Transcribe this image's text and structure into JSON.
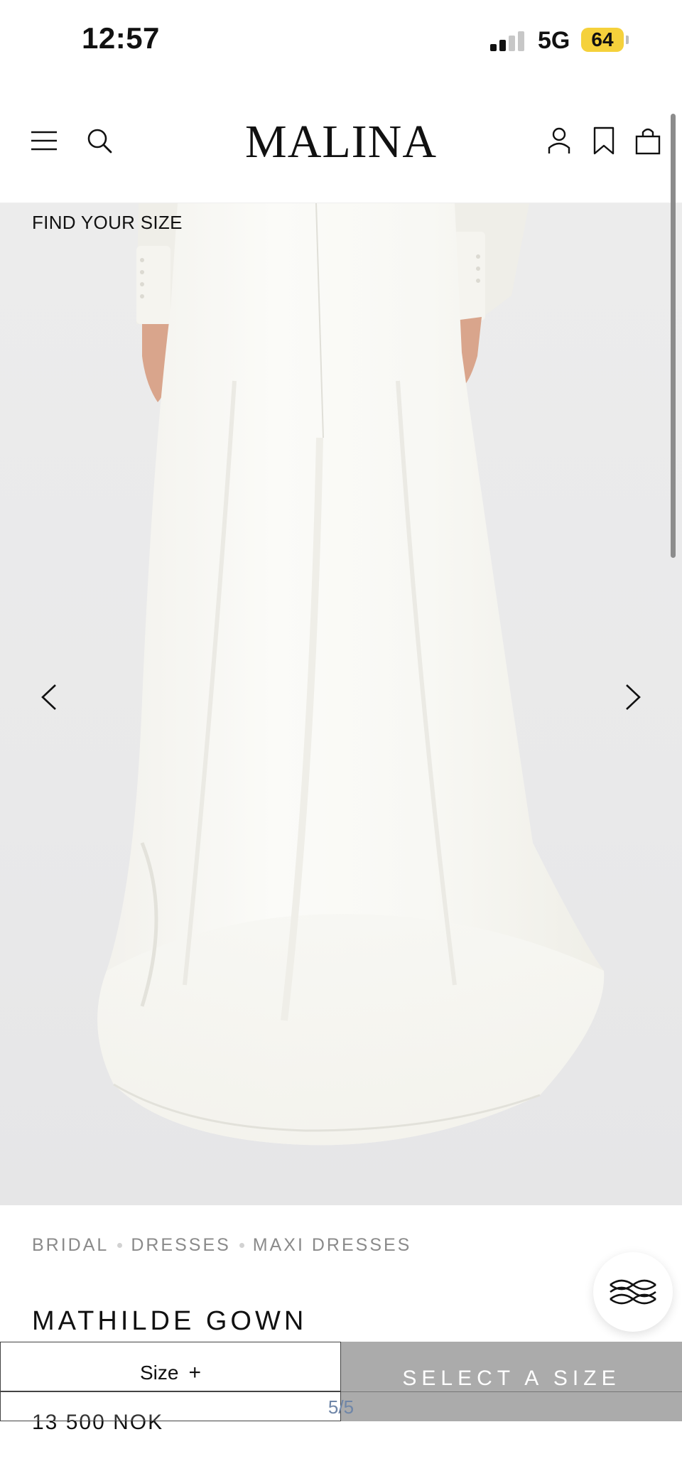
{
  "status_bar": {
    "time": "12:57",
    "network": "5G",
    "battery": "64",
    "battery_color": "#f5d13b"
  },
  "header": {
    "logo": "MALINA",
    "icons": [
      "menu-icon",
      "search-icon",
      "account-icon",
      "bookmark-icon",
      "bag-icon"
    ]
  },
  "hero": {
    "find_your_size": "FIND YOUR SIZE",
    "prev_icon": "chevron-left-icon",
    "next_icon": "chevron-right-icon"
  },
  "breadcrumb": {
    "items": [
      "BRIDAL",
      "DRESSES",
      "MAXI DRESSES"
    ]
  },
  "product": {
    "title": "MATHILDE GOWN",
    "price": "13 500 NOK"
  },
  "purchase_bar": {
    "size_label": "Size",
    "size_icon": "+",
    "select_size_label": "SELECT A SIZE",
    "select_size_color": "#ababab"
  },
  "gallery": {
    "pager": "5/5"
  }
}
